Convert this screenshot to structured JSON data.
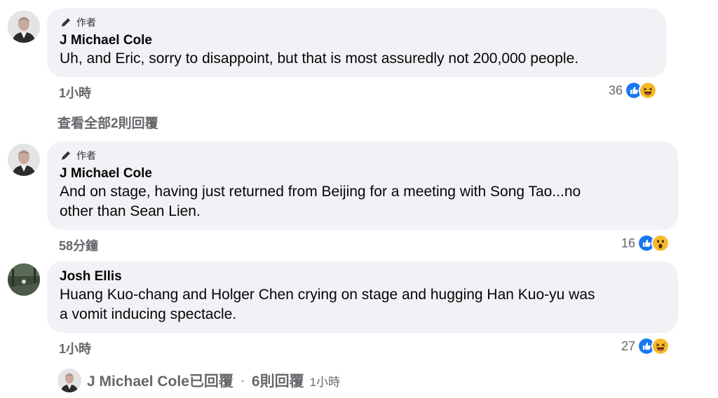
{
  "comments": [
    {
      "author_badge": "作者",
      "name": "J Michael Cole",
      "text": "Uh, and Eric, sorry to disappoint, but that is most assuredly not 200,000 people.",
      "time": "1小時",
      "reaction_count": "36",
      "reactions": [
        "like-icon",
        "haha-icon"
      ],
      "view_replies": "查看全部2則回覆"
    },
    {
      "author_badge": "作者",
      "name": "J Michael Cole",
      "text_line1": "And on stage, having just returned from Beijing for a meeting with Song Tao...no",
      "text_line2": "other than Sean Lien.",
      "time": "58分鐘",
      "reaction_count": "16",
      "reactions": [
        "like-icon",
        "wow-icon"
      ]
    },
    {
      "name": "Josh Ellis",
      "text_line1": "Huang Kuo-chang and Holger Chen crying on stage and hugging Han Kuo-yu was",
      "text_line2": "a vomit inducing spectacle.",
      "time": "1小時",
      "reaction_count": "27",
      "reactions": [
        "like-icon",
        "haha-icon"
      ]
    }
  ],
  "reply_summary": {
    "replier": "J Michael Cole已回覆",
    "separator": "·",
    "count": "6則回覆",
    "time": "1小時"
  },
  "colors": {
    "bubble": "#f0f2f5",
    "meta_gray": "#65676b",
    "like_blue": "#1877f2",
    "emoji_yellow": "#f7b928"
  }
}
